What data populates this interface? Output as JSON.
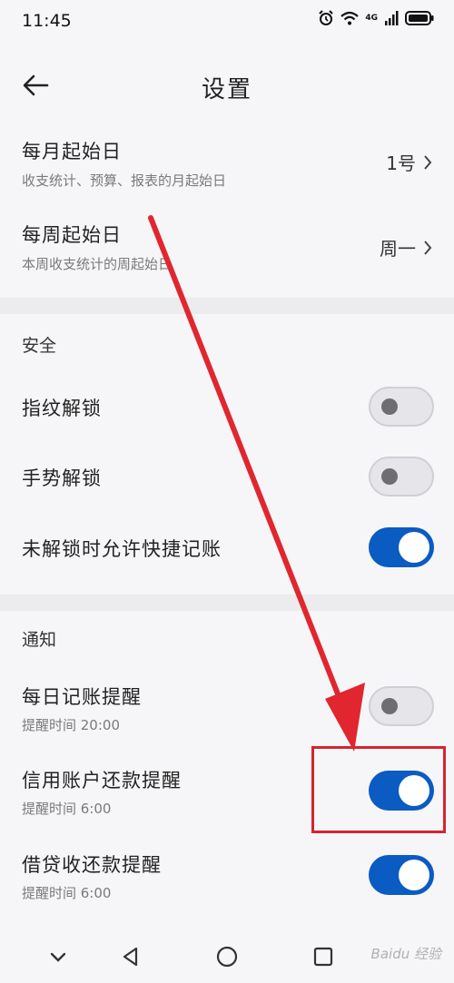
{
  "status_bar": {
    "time": "11:45",
    "network": "4G"
  },
  "header": {
    "title": "设置"
  },
  "month_start": {
    "title": "每月起始日",
    "subtitle": "收支统计、预算、报表的月起始日",
    "value": "1号"
  },
  "week_start": {
    "title": "每周起始日",
    "subtitle": "本周收支统计的周起始日",
    "value": "周一"
  },
  "security": {
    "heading": "安全",
    "items": [
      {
        "label": "指纹解锁",
        "enabled": false
      },
      {
        "label": "手势解锁",
        "enabled": false
      },
      {
        "label": "未解锁时允许快捷记账",
        "enabled": true
      }
    ]
  },
  "notifications": {
    "heading": "通知",
    "items": [
      {
        "label": "每日记账提醒",
        "subtitle": "提醒时间 20:00",
        "enabled": false
      },
      {
        "label": "信用账户还款提醒",
        "subtitle": "提醒时间 6:00",
        "enabled": true
      },
      {
        "label": "借贷收还款提醒",
        "subtitle": "提醒时间 6:00",
        "enabled": true
      }
    ]
  },
  "watermark": "Baidu 经验",
  "colors": {
    "accent": "#0a5bc2",
    "annotation": "#d8242e",
    "divider": "#ececef"
  },
  "icons": [
    "back-arrow-icon",
    "chevron-right-icon",
    "alarm-icon",
    "wifi-icon",
    "signal-icon",
    "battery-icon",
    "nav-down-icon",
    "nav-back-icon",
    "nav-home-icon",
    "nav-recents-icon"
  ]
}
